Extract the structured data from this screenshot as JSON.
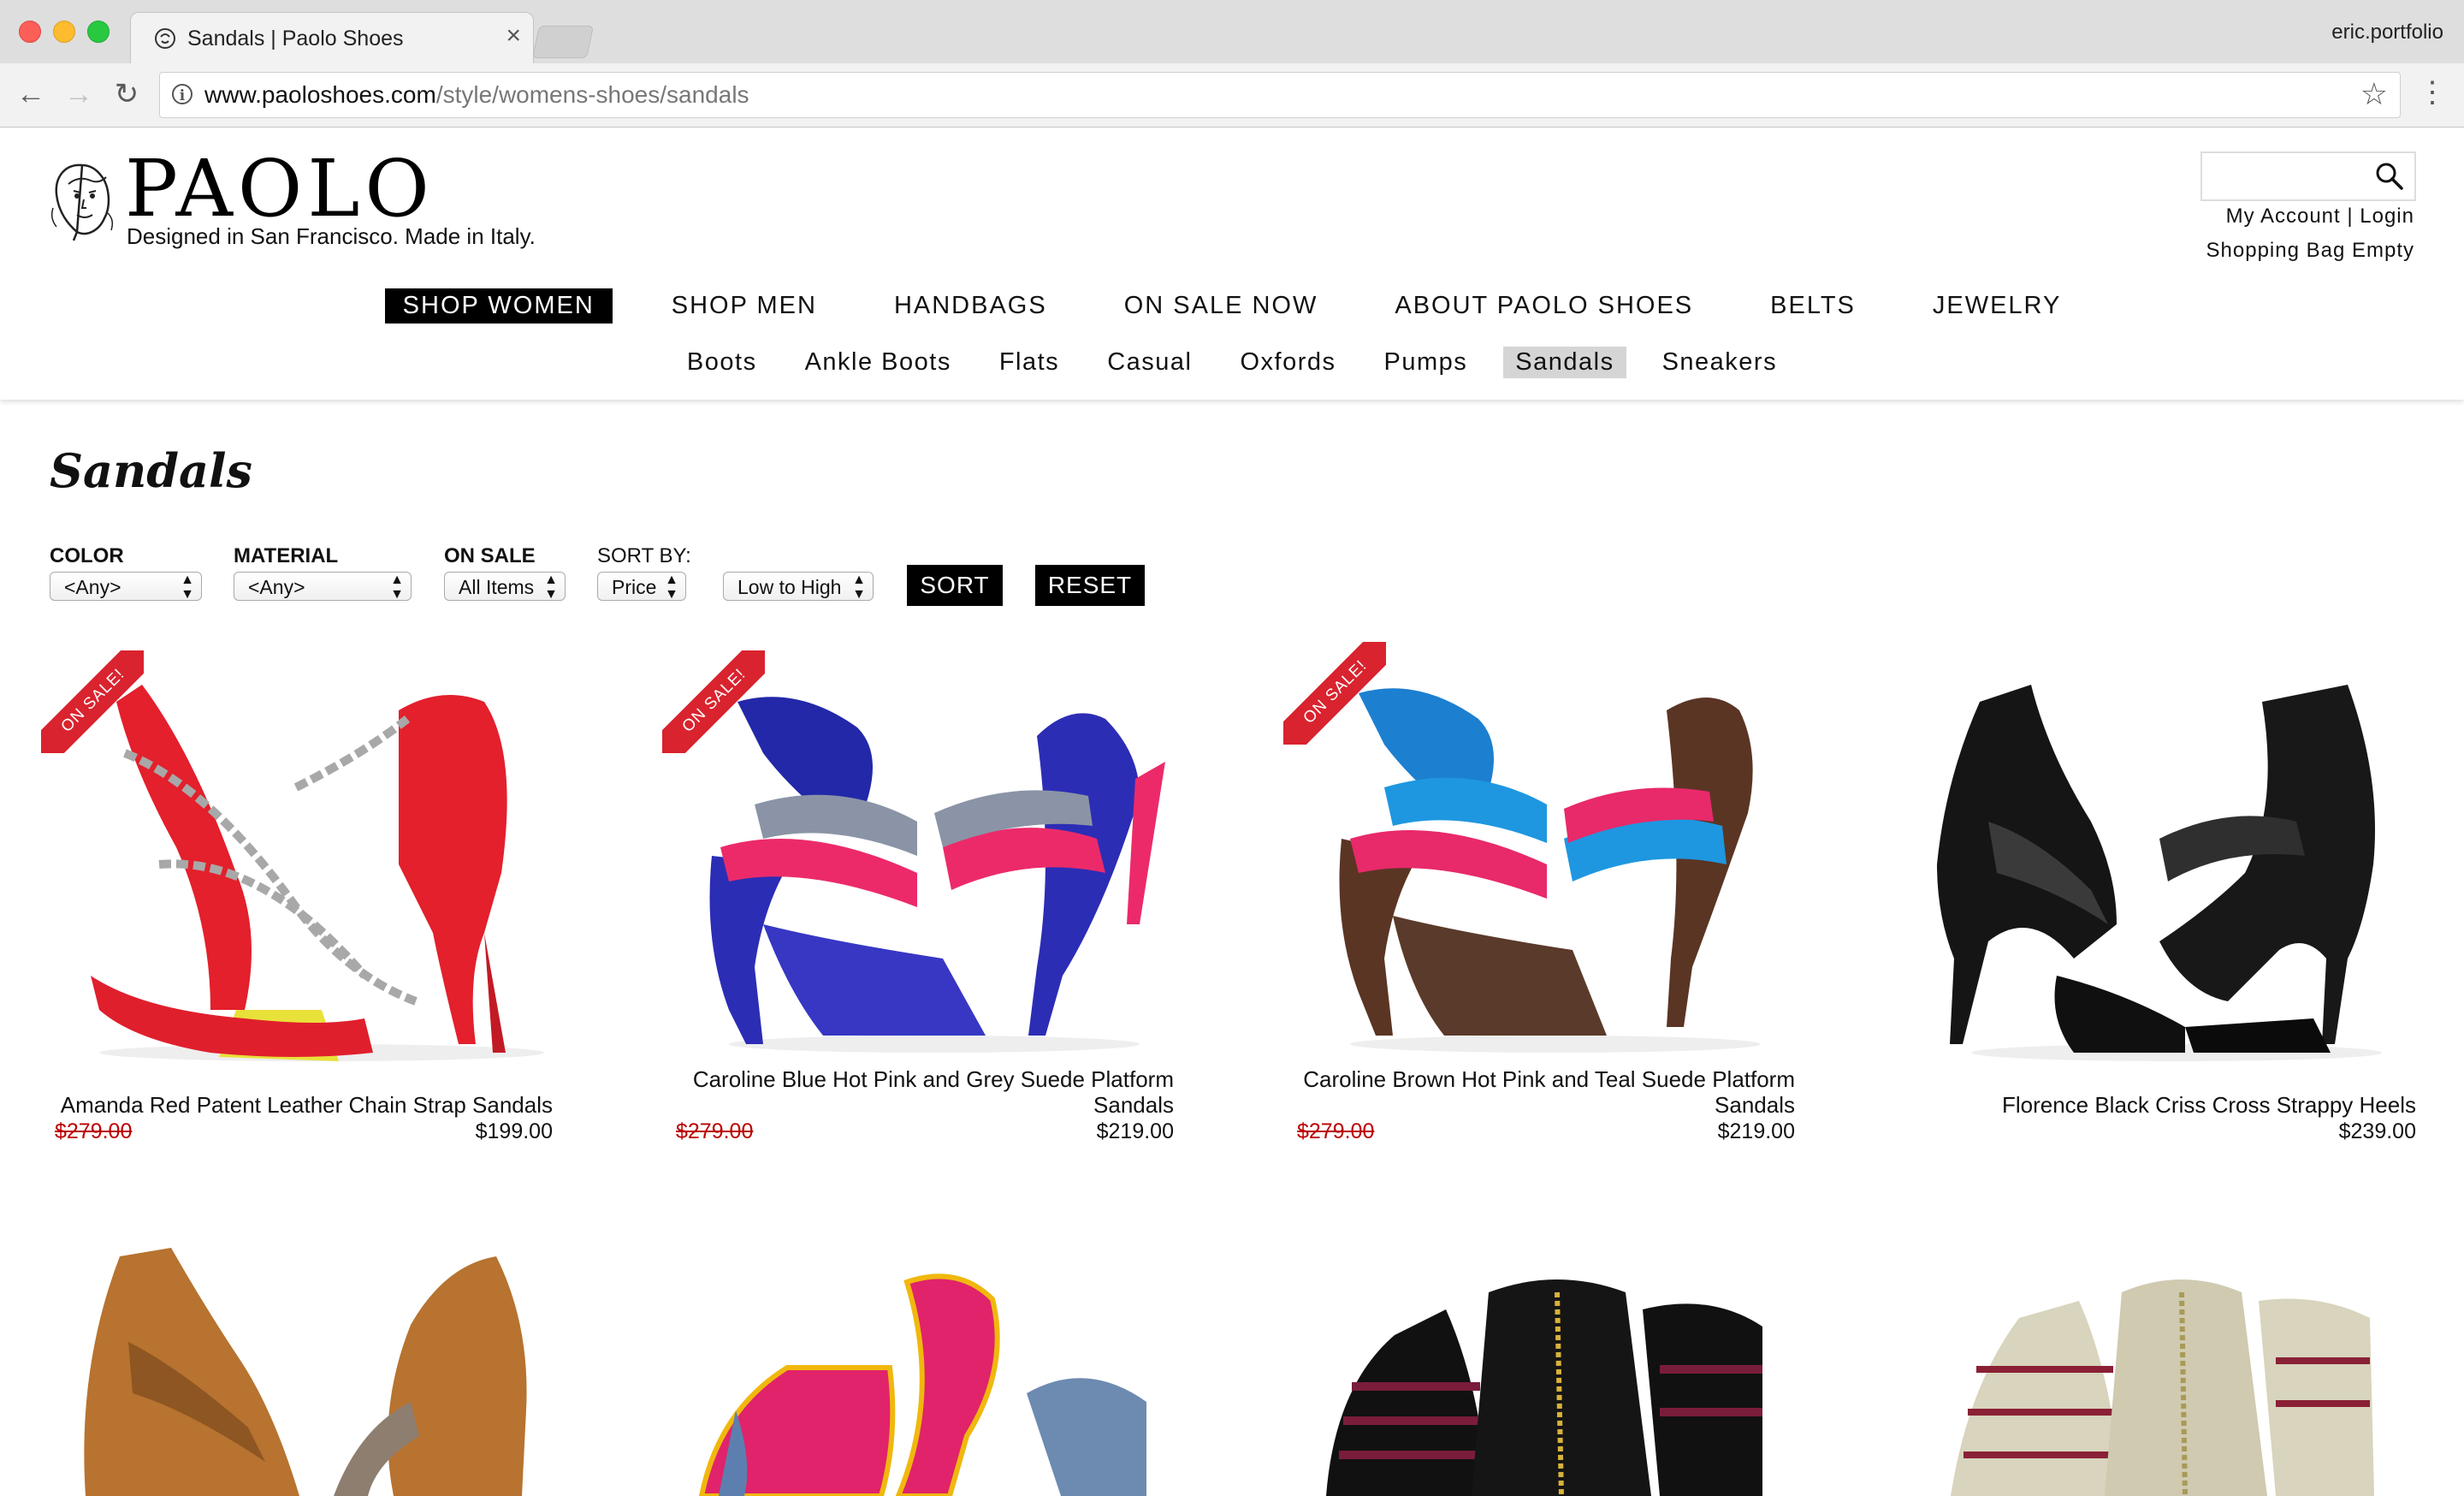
{
  "browser": {
    "tab_title": "Sandals | Paolo Shoes",
    "tab_close": "×",
    "profile": "eric.portfolio",
    "url_host": "www.paoloshoes.com",
    "url_path": "/style/womens-shoes/sandals",
    "back": "←",
    "forward": "→",
    "reload": "↻",
    "star": "☆",
    "menu": "⋮"
  },
  "site": {
    "logo_text": "PAOLO",
    "tagline": "Designed in San Francisco. Made in Italy.",
    "search_placeholder": "",
    "account_links": "My Account | Login",
    "bag_status": "Shopping Bag Empty"
  },
  "main_nav": [
    {
      "label": "SHOP WOMEN",
      "active": true
    },
    {
      "label": "SHOP MEN"
    },
    {
      "label": "HANDBAGS"
    },
    {
      "label": "ON SALE NOW"
    },
    {
      "label": "ABOUT PAOLO SHOES"
    },
    {
      "label": "BELTS"
    },
    {
      "label": "JEWELRY"
    }
  ],
  "sub_nav": [
    {
      "label": "Boots"
    },
    {
      "label": "Ankle Boots"
    },
    {
      "label": "Flats"
    },
    {
      "label": "Casual"
    },
    {
      "label": "Oxfords"
    },
    {
      "label": "Pumps"
    },
    {
      "label": "Sandals",
      "active": true
    },
    {
      "label": "Sneakers"
    }
  ],
  "page_title": "Sandals",
  "filters": {
    "color_label": "COLOR",
    "color_value": "<Any>",
    "material_label": "MATERIAL",
    "material_value": "<Any>",
    "sale_label": "ON SALE",
    "sale_value": "All Items",
    "sort_label": "SORT BY:",
    "sort_field": "Price",
    "sort_order": "Low to High",
    "sort_button": "SORT",
    "reset_button": "RESET"
  },
  "ribbon_text": "ON SALE!",
  "products": [
    {
      "name_line1": "Amanda Red Patent Leather Chain Strap Sandals",
      "name_line2": "",
      "old_price": "$279.00",
      "price": "$199.00",
      "on_sale": true
    },
    {
      "name_line1": "Caroline Blue Hot Pink and Grey Suede Platform",
      "name_line2": "Sandals",
      "old_price": "$279.00",
      "price": "$219.00",
      "on_sale": true
    },
    {
      "name_line1": "Caroline Brown Hot Pink and Teal Suede Platform",
      "name_line2": "Sandals",
      "old_price": "$279.00",
      "price": "$219.00",
      "on_sale": true
    },
    {
      "name_line1": "Florence Black Criss Cross Strappy Heels",
      "name_line2": "",
      "old_price": "",
      "price": "$239.00",
      "on_sale": false
    }
  ],
  "colors": {
    "accent_black": "#000000",
    "sale_red": "#d9232e",
    "old_price_red": "#bb0000"
  }
}
